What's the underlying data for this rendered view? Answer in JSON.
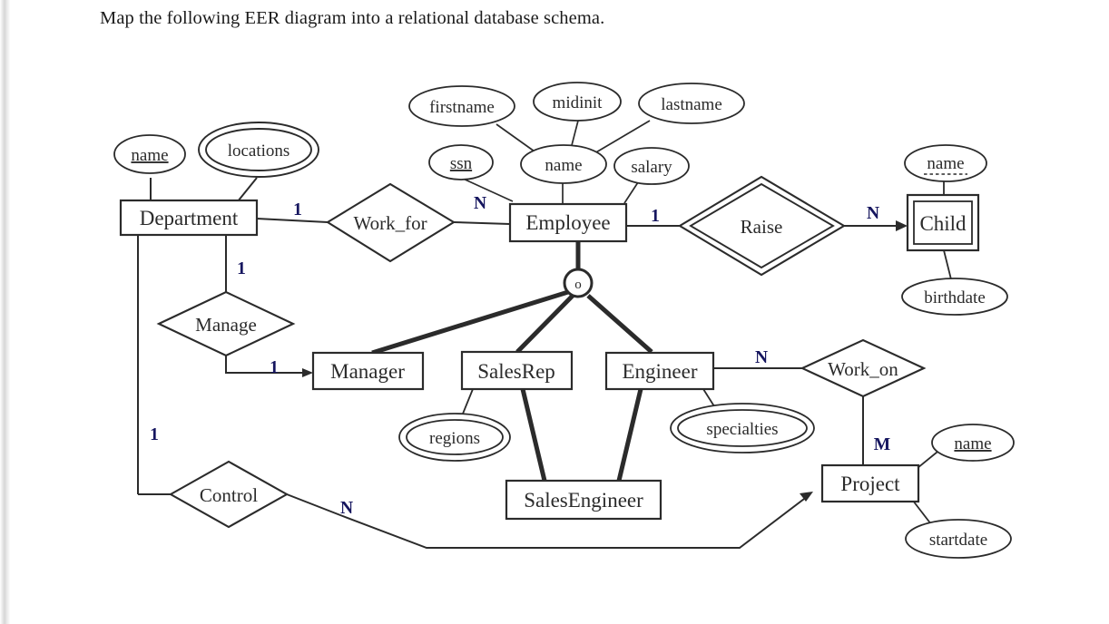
{
  "prompt": {
    "text": "Map the following EER diagram into a relational database schema."
  },
  "diagram": {
    "type": "EER diagram",
    "entities": [
      {
        "id": "department",
        "label": "Department",
        "kind": "strong-entity"
      },
      {
        "id": "employee",
        "label": "Employee",
        "kind": "strong-entity"
      },
      {
        "id": "child",
        "label": "Child",
        "kind": "weak-entity"
      },
      {
        "id": "manager",
        "label": "Manager",
        "kind": "subclass-entity"
      },
      {
        "id": "salesrep",
        "label": "SalesRep",
        "kind": "subclass-entity"
      },
      {
        "id": "engineer",
        "label": "Engineer",
        "kind": "subclass-entity"
      },
      {
        "id": "salesengineer",
        "label": "SalesEngineer",
        "kind": "category-entity"
      },
      {
        "id": "project",
        "label": "Project",
        "kind": "strong-entity"
      }
    ],
    "relationships": [
      {
        "id": "work_for",
        "label": "Work_for",
        "kind": "relationship"
      },
      {
        "id": "manage",
        "label": "Manage",
        "kind": "relationship"
      },
      {
        "id": "control",
        "label": "Control",
        "kind": "relationship"
      },
      {
        "id": "raise",
        "label": "Raise",
        "kind": "identifying-relationship"
      },
      {
        "id": "work_on",
        "label": "Work_on",
        "kind": "relationship"
      }
    ],
    "attributes": [
      {
        "id": "dept-name",
        "label": "name",
        "owner": "department",
        "kind": "key"
      },
      {
        "id": "dept-locations",
        "label": "locations",
        "owner": "department",
        "kind": "multivalued"
      },
      {
        "id": "emp-ssn",
        "label": "ssn",
        "owner": "employee",
        "kind": "key"
      },
      {
        "id": "emp-name",
        "label": "name",
        "owner": "employee",
        "kind": "composite"
      },
      {
        "id": "emp-firstname",
        "label": "firstname",
        "owner": "emp-name",
        "kind": "simple"
      },
      {
        "id": "emp-midinit",
        "label": "midinit",
        "owner": "emp-name",
        "kind": "simple"
      },
      {
        "id": "emp-lastname",
        "label": "lastname",
        "owner": "emp-name",
        "kind": "simple"
      },
      {
        "id": "emp-salary",
        "label": "salary",
        "owner": "employee",
        "kind": "simple"
      },
      {
        "id": "child-name",
        "label": "name",
        "owner": "child",
        "kind": "partial-key"
      },
      {
        "id": "child-birthdate",
        "label": "birthdate",
        "owner": "child",
        "kind": "simple"
      },
      {
        "id": "salesrep-regions",
        "label": "regions",
        "owner": "salesrep",
        "kind": "multivalued"
      },
      {
        "id": "engineer-specialties",
        "label": "specialties",
        "owner": "engineer",
        "kind": "multivalued"
      },
      {
        "id": "project-name",
        "label": "name",
        "owner": "project",
        "kind": "key"
      },
      {
        "id": "project-startdate",
        "label": "startdate",
        "owner": "project",
        "kind": "simple"
      }
    ],
    "specialization": {
      "id": "employee-specialization",
      "symbol": "o",
      "meaning": "overlapping",
      "superclass": "employee",
      "subclasses": [
        "manager",
        "salesrep",
        "engineer"
      ]
    },
    "cardinalities": {
      "dept_work_for": "1",
      "emp_work_for": "N",
      "dept_manage": "1",
      "manage_manager": "1",
      "dept_control": "1",
      "control_project": "N",
      "emp_raise": "1",
      "raise_child": "N",
      "engineer_work_on": "N",
      "work_on_project": "M"
    },
    "colors": {
      "stroke": "#2b2b2b",
      "fill": "#ffffff",
      "cardinality": "#16165f",
      "text": "#1a1a1a"
    }
  }
}
